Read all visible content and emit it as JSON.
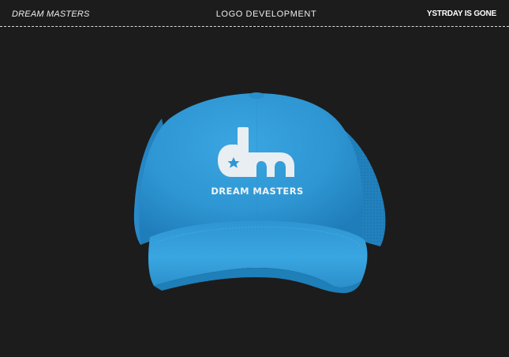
{
  "header": {
    "left_brand": "DREAM MASTERS",
    "center_title": "LOGO DEVELOPMENT",
    "right_brand": "YSTRDAY IS GONE"
  },
  "mockup": {
    "product": "trucker-cap",
    "cap_color": "#2e9ad6",
    "logo_monogram": "dm",
    "logo_caption": "DREAM MASTERS",
    "logo_color": "#e9eef2"
  },
  "colors": {
    "background": "#1c1c1c",
    "text": "#f2f2f2",
    "cap_shadow": "#1f7fb8"
  }
}
